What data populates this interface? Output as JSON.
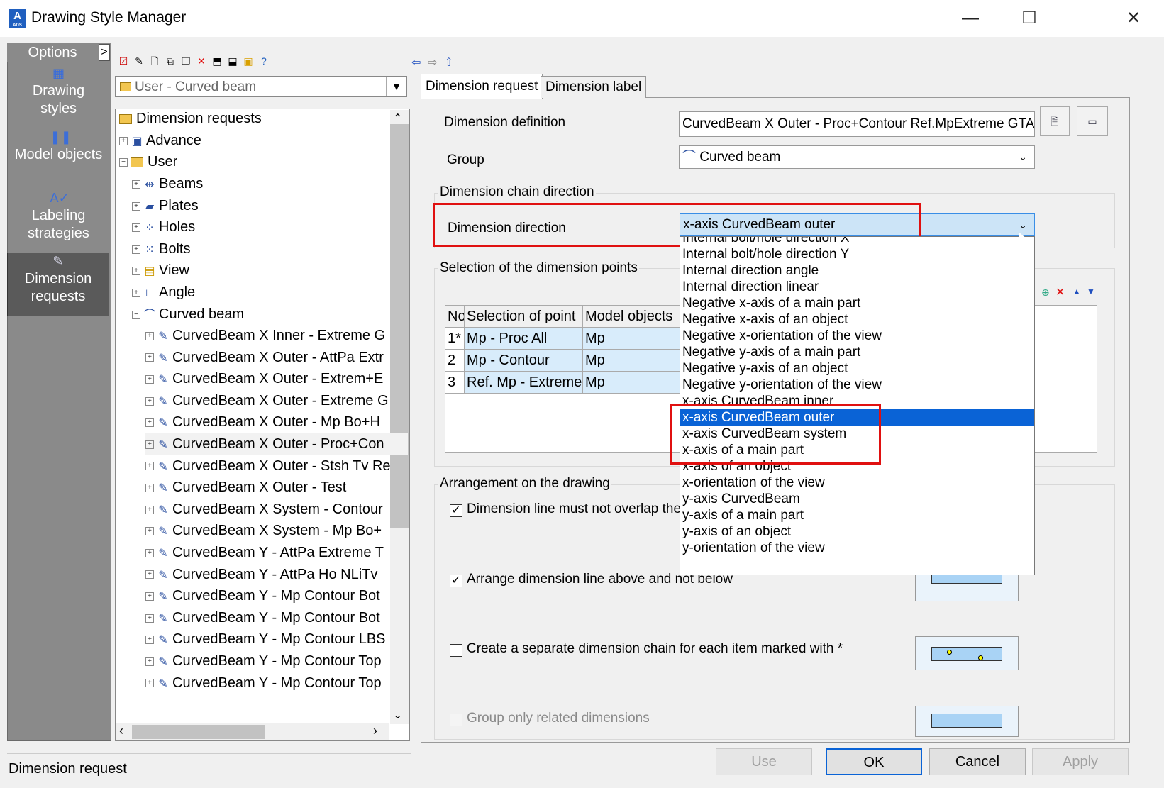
{
  "window": {
    "title": "Drawing Style Manager",
    "app_icon": "A",
    "app_icon_sub": "ADS",
    "minimize": "—",
    "maximize": "☐",
    "close": "✕"
  },
  "options": {
    "header": "Options",
    "expand": ">",
    "items": [
      {
        "label1": "Drawing",
        "label2": "styles",
        "icon": "drawing-styles-icon"
      },
      {
        "label1": "Model objects",
        "label2": "",
        "icon": "model-objects-icon"
      },
      {
        "label1": "Labeling",
        "label2": "strategies",
        "icon": "labeling-strategies-icon"
      },
      {
        "label1": "Dimension",
        "label2": "requests",
        "icon": "dimension-requests-icon"
      }
    ]
  },
  "style_selector": {
    "value": "User - Curved beam"
  },
  "tree": {
    "root": "Dimension requests",
    "advance": "Advance",
    "user": "User",
    "categories": [
      "Beams",
      "Plates",
      "Holes",
      "Bolts",
      "View",
      "Angle",
      "Curved beam"
    ],
    "items": [
      "CurvedBeam X Inner - Extreme G",
      "CurvedBeam X Outer - AttPa Extr",
      "CurvedBeam X Outer - Extrem+E",
      "CurvedBeam X Outer - Extreme G",
      "CurvedBeam X Outer - Mp Bo+H",
      "CurvedBeam X Outer - Proc+Con",
      "CurvedBeam X Outer - Stsh Tv Re",
      "CurvedBeam X Outer - Test",
      "CurvedBeam X System - Contour",
      "CurvedBeam X System - Mp Bo+",
      "CurvedBeam Y - AttPa Extreme T",
      "CurvedBeam Y - AttPa Ho NLiTv",
      "CurvedBeam Y - Mp Contour Bot",
      "CurvedBeam Y - Mp Contour Bot",
      "CurvedBeam Y - Mp Contour LBS",
      "CurvedBeam Y - Mp Contour Top",
      "CurvedBeam Y - Mp Contour Top"
    ]
  },
  "tabs": [
    "Dimension request",
    "Dimension label"
  ],
  "form": {
    "def_label": "Dimension definition",
    "def_value": "CurvedBeam X Outer - Proc+Contour Ref.MpExtreme GTA",
    "group_label": "Group",
    "group_value": "Curved beam",
    "chain_title": "Dimension chain direction",
    "dir_label": "Dimension direction",
    "dir_value": "x-axis CurvedBeam outer",
    "points_title": "Selection of the dimension points",
    "grid_headers": [
      "No",
      "Selection of point",
      "Model objects"
    ],
    "grid_rows": [
      {
        "no": "1*",
        "sel": "Mp - Proc All",
        "mo": "Mp"
      },
      {
        "no": "2",
        "sel": "Mp - Contour",
        "mo": "Mp"
      },
      {
        "no": "3",
        "sel": "Ref. Mp - Extreme",
        "mo": "Mp"
      }
    ],
    "arrange_title": "Arrangement on the drawing",
    "chk1": "Dimension line must not overlap the v",
    "chk2": "Arrange dimension line above and not below",
    "chk3": "Create a separate dimension chain for each item marked with *",
    "chk4": "Group only related dimensions",
    "chk1_checked": "✓",
    "chk2_checked": "✓"
  },
  "dropdown": {
    "options": [
      "Internal bolt/hole direction X",
      "Internal bolt/hole direction Y",
      "Internal direction angle",
      "Internal direction linear",
      "Negative x-axis of a main part",
      "Negative x-axis of an object",
      "Negative x-orientation of the view",
      "Negative y-axis of a main part",
      "Negative y-axis of an object",
      "Negative y-orientation of the view",
      "x-axis CurvedBeam inner",
      "x-axis CurvedBeam outer",
      "x-axis CurvedBeam system",
      "x-axis of a main part",
      "x-axis of an object",
      "x-orientation of the view",
      "y-axis CurvedBeam",
      "y-axis of a main part",
      "y-axis of an object",
      "y-orientation of the view"
    ],
    "selected": "x-axis CurvedBeam outer"
  },
  "buttons": {
    "use": "Use",
    "ok": "OK",
    "cancel": "Cancel",
    "apply": "Apply"
  },
  "status": "Dimension request",
  "colors": {
    "selection": "#0a63d6",
    "highlight_box": "#e01010",
    "field_focus": "#cce4f7"
  }
}
